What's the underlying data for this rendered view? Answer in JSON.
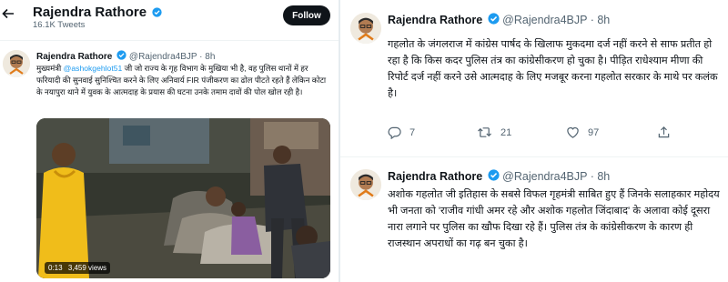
{
  "header": {
    "name": "Rajendra Rathore",
    "subtitle": "16.1K Tweets",
    "follow_label": "Follow"
  },
  "left_tweet": {
    "name": "Rajendra Rathore",
    "handle": "@Rajendra4BJP · 8h",
    "text_before": "मुख्यमंत्री ",
    "mention": "@ashokgehlot51",
    "text_after": " जी जो राज्य के गृह विभाग के मुखिया भी है, वह पुलिस थानों में हर फरियादी की सुनवाई सुनिश्चित करने के लिए अनिवार्य FIR पंजीकरण का ढोल पीटते रहते हैं लेकिन कोटा के नयापुरा थाने में युवक के आत्मदाह के प्रयास की घटना उनके तमाम दावों की पोल खोल रही है।",
    "video_time": "0:13",
    "video_views": "3,459 views"
  },
  "right_tweet_1": {
    "name": "Rajendra Rathore",
    "handle": "@Rajendra4BJP · 8h",
    "text": "गहलोत के जंगलराज में कांग्रेस पार्षद के खिलाफ मुकदमा दर्ज नहीं करने से साफ प्रतीत हो रहा है कि किस कदर पुलिस तंत्र का कांग्रेसीकरण हो चुका है। पीड़ित राधेश्याम मीणा की रिपोर्ट दर्ज नहीं करने उसे आत्मदाह के लिए मजबूर करना गहलोत सरकार के माथे पर कलंक है।",
    "replies": "7",
    "retweets": "21",
    "likes": "97"
  },
  "right_tweet_2": {
    "name": "Rajendra Rathore",
    "handle": "@Rajendra4BJP · 8h",
    "text": "अशोक गहलोत जी इतिहास के सबसे विफल गृहमंत्री साबित हुए हैं जिनके सलाहकार महोदय भी जनता को 'राजीव गांधी अमर रहे और अशोक गहलोत जिंदाबाद' के अलावा कोई दूसरा नारा लगाने पर पुलिस का खौफ दिखा रहे हैं। पुलिस तंत्र के कांग्रेसीकरण के कारण ही राजस्थान अपराधों का गढ़ बन चुका है।"
  },
  "icons": {
    "back": "arrow-left-icon",
    "verified": "verified-badge-icon",
    "reply": "reply-icon",
    "retweet": "retweet-icon",
    "like": "heart-icon",
    "share": "share-icon"
  },
  "colors": {
    "accent": "#1d9bf0",
    "text": "#0f1419",
    "muted": "#536471",
    "follow_bg": "#0f1419"
  }
}
